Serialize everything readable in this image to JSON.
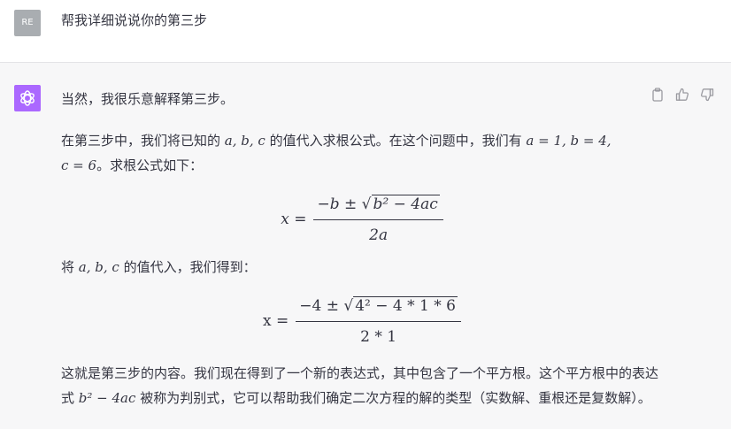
{
  "user": {
    "avatar": "RE",
    "message": "帮我详细说说你的第三步"
  },
  "assistant": {
    "avatar_icon": "openai-logo-icon",
    "avatar_color": "#ab68ff",
    "actions": [
      "copy-icon",
      "thumbs-up-icon",
      "thumbs-down-icon"
    ],
    "intro": "当然，我很乐意解释第三步。",
    "p1": {
      "a": "在第三步中，我们将已知的",
      "vars": "a, b, c",
      "b": "的值代入求根公式。在这个问题中，我们有",
      "eq1": "a = 1, b = 4,",
      "eq2": "c = 6",
      "c": "。求根公式如下："
    },
    "formula1": {
      "lhs": "x =",
      "num_pre": "−b ± ",
      "sqrt_sign": "√",
      "sqrt_body": "b² − 4ac",
      "den": "2a"
    },
    "p2": {
      "a": "将",
      "vars": "a, b, c",
      "b": "的值代入，我们得到："
    },
    "formula2": {
      "lhs": "x =",
      "num_pre": "−4 ± ",
      "sqrt_sign": "√",
      "sqrt_body": "4² − 4 * 1 * 6",
      "den": "2 * 1"
    },
    "p3": {
      "a": "这就是第三步的内容。我们现在得到了一个新的表达式，其中包含了一个平方根。这个平方根中的表达式",
      "expr": "b² − 4ac",
      "b": "被称为判别式，它可以帮助我们确定二次方程的解的类型（实数解、重根还是复数解）。"
    }
  }
}
